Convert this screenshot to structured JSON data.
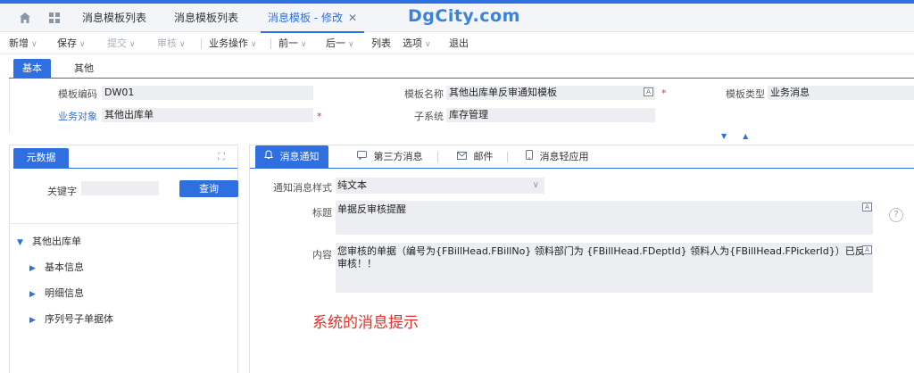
{
  "watermark": "DgCity.com",
  "tabs": [
    {
      "label": "消息模板列表"
    },
    {
      "label": "消息模板列表"
    },
    {
      "label": "消息模板 - 修改"
    }
  ],
  "toolbar": {
    "new": "新增",
    "save": "保存",
    "submit": "提交",
    "audit": "审核",
    "business_ops": "业务操作",
    "prev": "前一",
    "next": "后一",
    "list": "列表",
    "options": "选项",
    "exit": "退出"
  },
  "subtabs": [
    "基本",
    "其他"
  ],
  "form": {
    "code_label": "模板编码",
    "code_value": "DW01",
    "name_label": "模板名称",
    "name_value": "其他出库单反审通知模板",
    "type_label": "模板类型",
    "type_value": "业务消息",
    "object_label": "业务对象",
    "object_value": "其他出库单",
    "subsystem_label": "子系统",
    "subsystem_value": "库存管理",
    "required_mark": "*"
  },
  "left_panel": {
    "tab": "元数据",
    "keyword_label": "关键字",
    "keyword_value": "",
    "query_button": "查询",
    "tree": [
      {
        "label": "其他出库单",
        "level": 0,
        "expanded": true
      },
      {
        "label": "基本信息",
        "level": 1,
        "expanded": false
      },
      {
        "label": "明细信息",
        "level": 1,
        "expanded": false
      },
      {
        "label": "序列号子单据体",
        "level": 1,
        "expanded": false
      }
    ]
  },
  "right_panel": {
    "tabs": [
      {
        "label": "消息通知",
        "icon": "bell-icon"
      },
      {
        "label": "第三方消息",
        "icon": "chat-icon"
      },
      {
        "label": "邮件",
        "icon": "mail-icon"
      },
      {
        "label": "消息轻应用",
        "icon": "phone-icon"
      }
    ],
    "style_label": "通知消息样式",
    "style_value": "纯文本",
    "title_label": "标题",
    "title_value": "单据反审核提醒",
    "content_label": "内容",
    "content_value": "您审核的单据（编号为{FBillHead.FBillNo} 领料部门为 {FBillHead.FDeptId} 领料人为{FBillHead.FPickerId}）已反审核！！",
    "note": "系统的消息提示"
  },
  "colors": {
    "accent": "#2f6fe0",
    "required": "#e0322b",
    "field_bg": "#eceef1"
  }
}
